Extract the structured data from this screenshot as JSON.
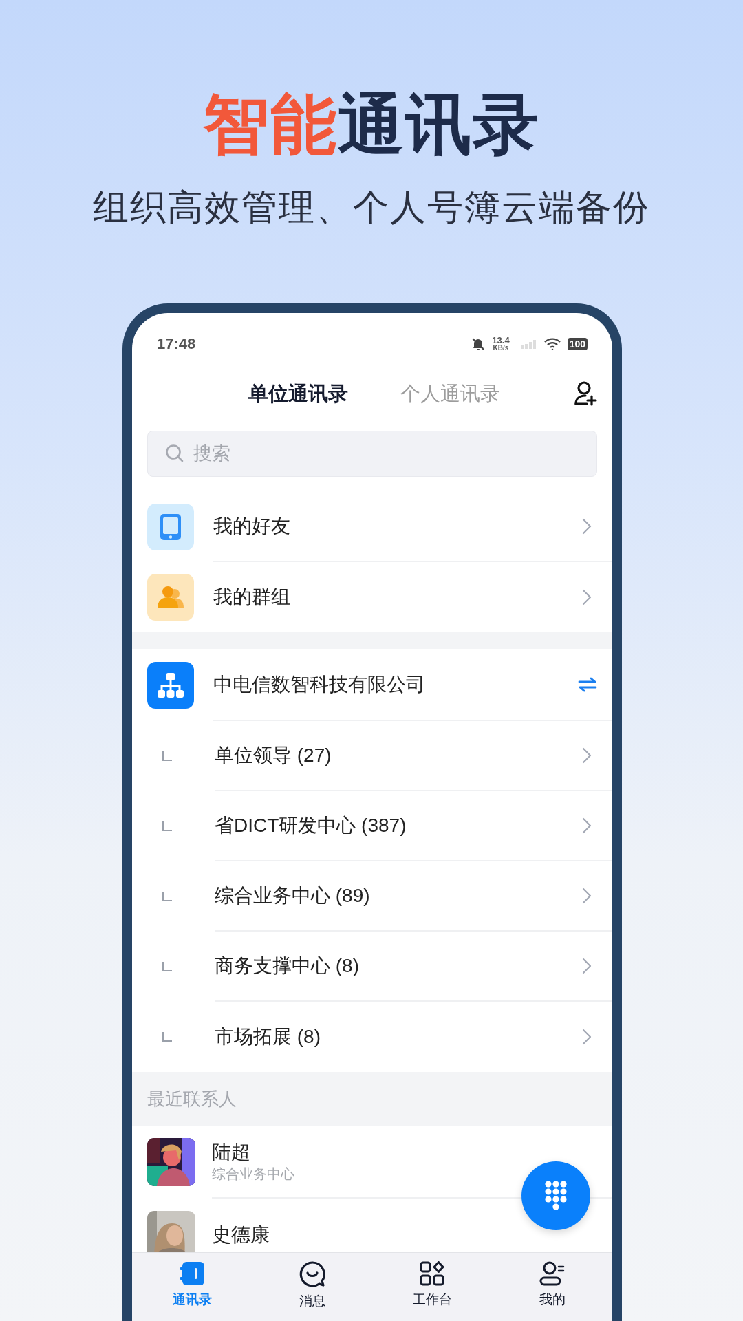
{
  "hero": {
    "title_highlight": "智能",
    "title_rest": "通讯录",
    "subtitle": "组织高效管理、个人号簿云端备份"
  },
  "status_bar": {
    "time": "17:48",
    "net_speed": "13.4",
    "net_unit": "KB/s",
    "battery": "100"
  },
  "tabs": [
    {
      "label": "单位通讯录",
      "selected": true
    },
    {
      "label": "个人通讯录",
      "selected": false
    }
  ],
  "search": {
    "placeholder": "搜索"
  },
  "quick_items": [
    {
      "kind": "phone",
      "label": "我的好友"
    },
    {
      "kind": "group",
      "label": "我的群组"
    }
  ],
  "organization": {
    "name": "中电信数智科技有限公司",
    "departments": [
      {
        "label": "单位领导 (27)"
      },
      {
        "label": "省DICT研发中心 (387)"
      },
      {
        "label": "综合业务中心 (89)"
      },
      {
        "label": "商务支撑中心 (8)"
      },
      {
        "label": "市场拓展 (8)"
      }
    ]
  },
  "recent": {
    "header": "最近联系人",
    "contacts": [
      {
        "name": "陆超",
        "department": "综合业务中心"
      },
      {
        "name": "史德康"
      }
    ]
  },
  "nav": [
    {
      "kind": "contacts",
      "label": "通讯录",
      "selected": true
    },
    {
      "kind": "messages",
      "label": "消息",
      "selected": false
    },
    {
      "kind": "workbench",
      "label": "工作台",
      "selected": false
    },
    {
      "kind": "me",
      "label": "我的",
      "selected": false
    }
  ]
}
